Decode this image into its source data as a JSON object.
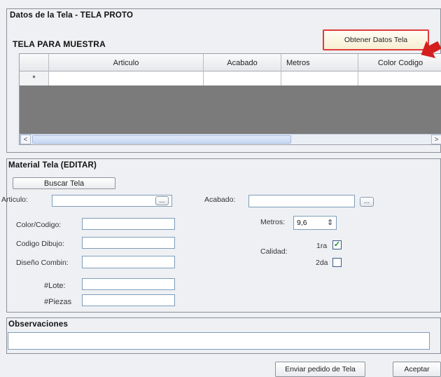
{
  "tela_panel": {
    "title": "Datos de la Tela - TELA PROTO",
    "subtitle": "TELA PARA MUESTRA",
    "get_data_button": "Obtener Datos Tela"
  },
  "grid": {
    "columns": [
      "Articulo",
      "Acabado",
      "Metros",
      "Color Codigo"
    ],
    "new_row_marker": "*",
    "scroll_left": "<",
    "scroll_right": ">"
  },
  "material_panel": {
    "title": "Material Tela (EDITAR)",
    "search_button": "Buscar Tela",
    "articulo_label": "Articulo:",
    "articulo_value": "",
    "acabado_label": "Acabado:",
    "acabado_value": "",
    "combo_glyph": "...",
    "color_label": "Color/Codigo:",
    "color_value": "",
    "dibujo_label": "Codigo Dibujo:",
    "dibujo_value": "",
    "diseno_label": "Diseño Combin:",
    "diseno_value": "",
    "lote_label": "#Lote:",
    "lote_value": "",
    "piezas_label": "#Piezas",
    "piezas_value": "",
    "metros_label": "Metros:",
    "metros_value": "9,6",
    "calidad_label": "Calidad:",
    "primera_label": "1ra",
    "primera_checked": true,
    "segunda_label": "2da",
    "segunda_checked": false,
    "check_glyph": "✓",
    "spin_glyph": "⇕"
  },
  "observaciones": {
    "title": "Observaciones",
    "value": ""
  },
  "footer": {
    "send_button": "Enviar pedido de Tela",
    "accept_button": "Aceptar"
  },
  "colors": {
    "highlight": "#e23a3a",
    "arrow": "#d41f1f",
    "grid_empty": "#7b7b7b",
    "check": "#1a8a24"
  }
}
